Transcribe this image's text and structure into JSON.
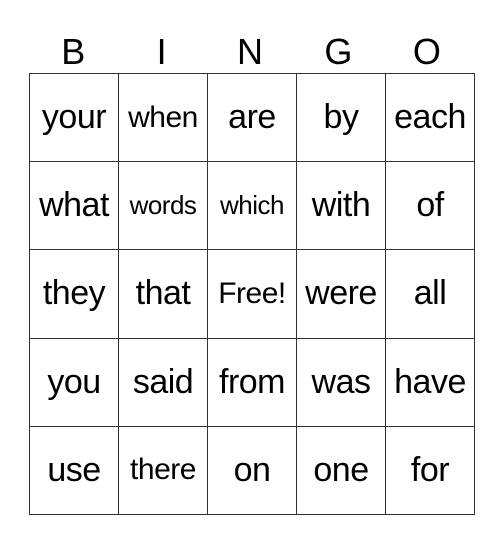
{
  "header": [
    "B",
    "I",
    "N",
    "G",
    "O"
  ],
  "rows": [
    [
      "your",
      "when",
      "are",
      "by",
      "each"
    ],
    [
      "what",
      "words",
      "which",
      "with",
      "of"
    ],
    [
      "they",
      "that",
      "Free!",
      "were",
      "all"
    ],
    [
      "you",
      "said",
      "from",
      "was",
      "have"
    ],
    [
      "use",
      "there",
      "on",
      "one",
      "for"
    ]
  ]
}
